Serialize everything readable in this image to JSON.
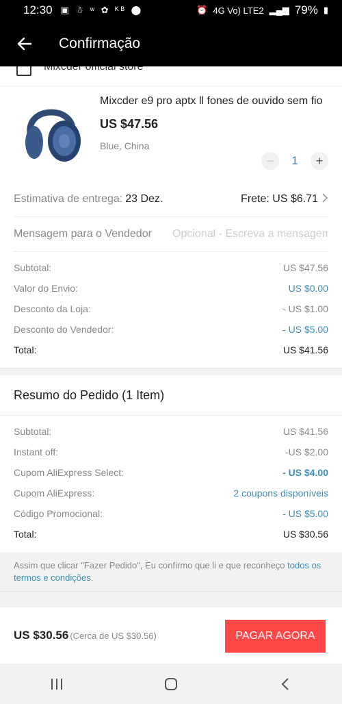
{
  "status_bar": {
    "time": "12:30",
    "notifications": "▣ ☃ ʷ ✿ ᴷᴮ ⬤",
    "signal": "4G  Vo) LTE2",
    "battery": "79%"
  },
  "header": {
    "title": "Confirmação",
    "back_icon": "arrow-left-icon"
  },
  "store": {
    "name": "Mixcder official store"
  },
  "product": {
    "name": "Mixcder e9 pro aptx ll fones de ouvido sem fio",
    "price": "US $47.56",
    "variant": "Blue, China",
    "quantity": "1",
    "minus": "−",
    "plus": "+"
  },
  "delivery": {
    "label": "Estimativa de entrega:",
    "value": "23 Dez.",
    "shipping": "Frete: US $6.71"
  },
  "message": {
    "label": "Mensagem para o Vendedor",
    "placeholder": "Opcional - Escreva a mensagem"
  },
  "store_summary": [
    {
      "label": "Subtotal:",
      "value": "US $47.56",
      "style": "grey"
    },
    {
      "label": "Valor do Envio:",
      "value": "US $0.00",
      "style": "blue"
    },
    {
      "label": "Desconto da Loja:",
      "value": "- US $1.00",
      "style": "grey"
    },
    {
      "label": "Desconto do Vendedor:",
      "value": "- US $5.00",
      "style": "blue"
    },
    {
      "label": "Total:",
      "value": "US $41.56",
      "style": "total"
    }
  ],
  "order_summary": {
    "title": "Resumo do Pedido (1 Item)",
    "rows": [
      {
        "label": "Subtotal:",
        "value": "US $41.56",
        "style": "grey"
      },
      {
        "label": "Instant off:",
        "value": "-US $2.00",
        "style": "grey"
      },
      {
        "label": "Cupom AliExpress Select:",
        "value": "- US $4.00",
        "style": "bold-blue"
      },
      {
        "label": "Cupom AliExpress:",
        "value": "2 coupons disponíveis",
        "style": "blue"
      },
      {
        "label": "Código Promocional:",
        "value": "- US $5.00",
        "style": "blue"
      },
      {
        "label": "Total:",
        "value": "US $30.56",
        "style": "total"
      }
    ]
  },
  "terms": {
    "text": "Assim que clicar \"Fazer Pedido\", Eu confirmo que li e que reconheço ",
    "link": "todos os termos e condições",
    "end": "."
  },
  "paybar": {
    "total": "US $30.56",
    "approx": "(Cerca de US $30.56)",
    "button": "PAGAR AGORA"
  },
  "colors": {
    "accent_blue": "#3a8fb7",
    "pay_red": "#ff4747",
    "header_black": "#000000"
  }
}
